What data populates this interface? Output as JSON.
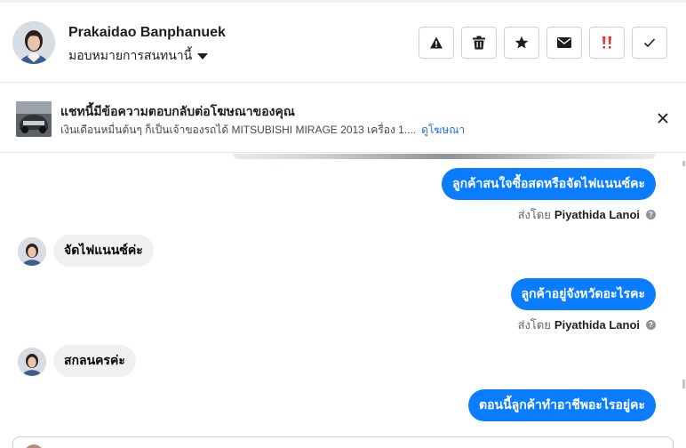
{
  "header": {
    "contact_name": "Prakaidao Banphanuek",
    "assign_label": "มอบหมายการสนทนานี้",
    "actions": [
      {
        "name": "report-spam-button",
        "icon": "warning-icon"
      },
      {
        "name": "delete-button",
        "icon": "trash-icon"
      },
      {
        "name": "star-button",
        "icon": "star-icon"
      },
      {
        "name": "mark-unread-button",
        "icon": "envelope-icon"
      },
      {
        "name": "follow-up-button",
        "icon": "double-exclamation-icon"
      },
      {
        "name": "mark-done-button",
        "icon": "checkmark-icon"
      }
    ]
  },
  "ad": {
    "title": "แชทนี้มีข้อความตอบกลับต่อโฆษณาของคุณ",
    "description": "เงินเดือนหมื่นต้นๆ ก็เป็นเจ้าของรถได้ MITSUBISHI MIRAGE 2013 เครื่อง 1....",
    "link": "ดูโฆษณา"
  },
  "messages": [
    {
      "dir": "out",
      "text": "ลูกค้าสนใจซื้อสดหรือจัดไฟแนนซ์คะ",
      "sent_by_prefix": "ส่งโดย",
      "sent_by_name": "Piyathida Lanoi"
    },
    {
      "dir": "in",
      "text": "จัดไฟแนนซ์ค่ะ"
    },
    {
      "dir": "out",
      "text": "ลูกค้าอยู่จังหวัดอะไรคะ",
      "sent_by_prefix": "ส่งโดย",
      "sent_by_name": "Piyathida Lanoi"
    },
    {
      "dir": "in",
      "text": "สกลนครค่ะ"
    },
    {
      "dir": "out",
      "text": "ตอนนี้ลูกค้าทำอาชีพอะไรอยู่คะ"
    }
  ],
  "colors": {
    "outgoing_bubble": "#0a7cff",
    "incoming_bubble": "#f0f0f0",
    "link": "#216fdb",
    "follow_up_icon": "#e0393e"
  }
}
